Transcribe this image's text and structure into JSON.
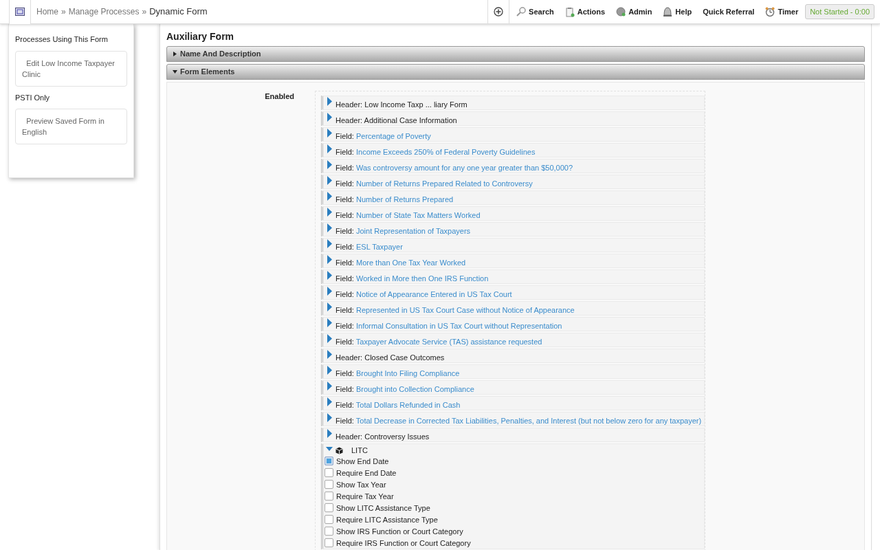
{
  "breadcrumb": [
    {
      "label": "Home"
    },
    {
      "label": "Manage Processes"
    },
    {
      "label": "Dynamic Form"
    }
  ],
  "breadcrumb_separator": "»",
  "toolbar": [
    {
      "label": "Search"
    },
    {
      "label": "Actions"
    },
    {
      "label": "Admin"
    },
    {
      "label": "Help"
    },
    {
      "label": "Quick Referral"
    },
    {
      "label": "Timer"
    }
  ],
  "timer_status": "Not Started - 0:00",
  "sidebar": {
    "title": "Processes Using This Form",
    "links": [
      {
        "label": "Edit Low Income Taxpayer Clinic"
      }
    ],
    "section": "PSTI Only",
    "section_links": [
      {
        "label": "Preview Saved Form in English"
      }
    ]
  },
  "page_title": "Auxiliary Form",
  "panels": [
    {
      "title": "Name And Description",
      "expanded": false
    },
    {
      "title": "Form Elements",
      "expanded": true
    }
  ],
  "enabled_label": "Enabled",
  "elements": [
    {
      "kind": "header",
      "prefix": "Header:",
      "name": "Low Income Taxp ... liary Form",
      "expanded": false
    },
    {
      "kind": "header",
      "prefix": "Header:",
      "name": "Additional Case Information",
      "expanded": false
    },
    {
      "kind": "field",
      "prefix": "Field:",
      "name": "Percentage of Poverty",
      "expanded": false
    },
    {
      "kind": "field",
      "prefix": "Field:",
      "name": "Income Exceeds 250% of Federal Poverty Guidelines",
      "expanded": false
    },
    {
      "kind": "field",
      "prefix": "Field:",
      "name": "Was controversy amount for any one year greater than $50,000?",
      "expanded": false
    },
    {
      "kind": "field",
      "prefix": "Field:",
      "name": "Number of Returns Prepared Related to Controversy",
      "expanded": false
    },
    {
      "kind": "field",
      "prefix": "Field:",
      "name": "Number of Returns Prepared",
      "expanded": false
    },
    {
      "kind": "field",
      "prefix": "Field:",
      "name": "Number of State Tax Matters Worked",
      "expanded": false
    },
    {
      "kind": "field",
      "prefix": "Field:",
      "name": "Joint Representation of Taxpayers",
      "expanded": false
    },
    {
      "kind": "field",
      "prefix": "Field:",
      "name": "ESL Taxpayer",
      "expanded": false
    },
    {
      "kind": "field",
      "prefix": "Field:",
      "name": "More than One Tax Year Worked",
      "expanded": false
    },
    {
      "kind": "field",
      "prefix": "Field:",
      "name": "Worked in More then One IRS Function",
      "expanded": false
    },
    {
      "kind": "field",
      "prefix": "Field:",
      "name": "Notice of Appearance Entered in US Tax Court",
      "expanded": false
    },
    {
      "kind": "field",
      "prefix": "Field:",
      "name": "Represented in US Tax Court Case without Notice of Appearance",
      "expanded": false
    },
    {
      "kind": "field",
      "prefix": "Field:",
      "name": "Informal Consultation in US Tax Court without Representation",
      "expanded": false
    },
    {
      "kind": "field",
      "prefix": "Field:",
      "name": "Taxpayer Advocate Service (TAS) assistance requested",
      "expanded": false
    },
    {
      "kind": "header",
      "prefix": "Header:",
      "name": "Closed Case Outcomes",
      "expanded": false
    },
    {
      "kind": "field",
      "prefix": "Field:",
      "name": "Brought Into Filing Compliance",
      "expanded": false
    },
    {
      "kind": "field",
      "prefix": "Field:",
      "name": "Brought into Collection Compliance",
      "expanded": false
    },
    {
      "kind": "field",
      "prefix": "Field:",
      "name": "Total Dollars Refunded in Cash",
      "expanded": false
    },
    {
      "kind": "field",
      "prefix": "Field:",
      "name": "Total Decrease in Corrected Tax Liabilities, Penalties, and Interest (but not below zero for any taxpayer)",
      "expanded": false
    },
    {
      "kind": "header",
      "prefix": "Header:",
      "name": "Controversy Issues",
      "expanded": false
    },
    {
      "kind": "module",
      "name": "LITC",
      "expanded": true,
      "options": [
        {
          "label": "Show End Date",
          "checked": true
        },
        {
          "label": "Require End Date",
          "checked": false
        },
        {
          "label": "Show Tax Year",
          "checked": false
        },
        {
          "label": "Require Tax Year",
          "checked": false
        },
        {
          "label": "Show LITC Assistance Type",
          "checked": false
        },
        {
          "label": "Require LITC Assistance Type",
          "checked": false
        },
        {
          "label": "Show IRS Function or Court Category",
          "checked": false
        },
        {
          "label": "Require IRS Function or Court Category",
          "checked": false
        }
      ]
    }
  ]
}
